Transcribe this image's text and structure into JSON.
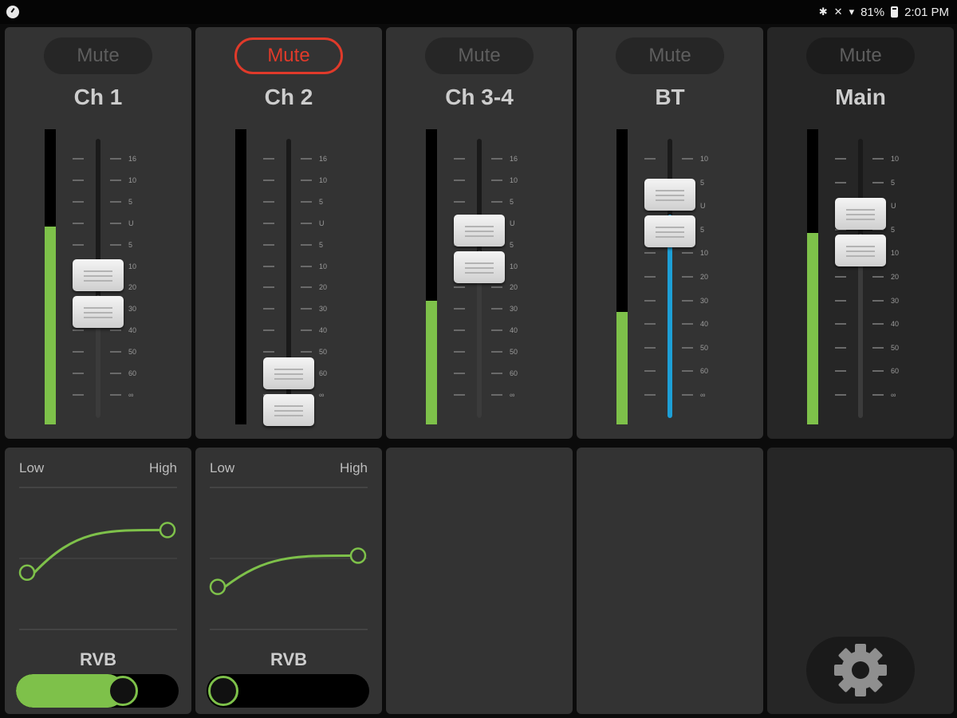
{
  "status_bar": {
    "left_icon": "app-notification-icon",
    "icons": [
      "bluetooth-icon",
      "mute-notifications-icon",
      "wifi-icon"
    ],
    "battery": "81%",
    "battery_level": 0.81,
    "time": "2:01 PM"
  },
  "fader_scale_channel": [
    "16",
    "10",
    "5",
    "U",
    "5",
    "10",
    "20",
    "30",
    "40",
    "50",
    "60",
    "∞"
  ],
  "fader_scale_bt": [
    "10",
    "5",
    "U",
    "5",
    "10",
    "20",
    "30",
    "40",
    "50",
    "60",
    "∞"
  ],
  "fader_scale_main": [
    "10",
    "5",
    "U",
    "5",
    "10",
    "20",
    "30",
    "40",
    "50",
    "60",
    "∞"
  ],
  "channels": [
    {
      "name": "Ch 1",
      "mute_label": "Mute",
      "muted": false,
      "meter_level": 0.67,
      "fader_level": 0.44,
      "fader_fill_color": "#3b3b3b"
    },
    {
      "name": "Ch 2",
      "mute_label": "Mute",
      "muted": true,
      "meter_level": 0.0,
      "fader_level": 0.0,
      "fader_fill_color": "#3b3b3b"
    },
    {
      "name": "Ch 3-4",
      "mute_label": "Mute",
      "muted": false,
      "meter_level": 0.42,
      "fader_level": 0.6,
      "fader_fill_color": "#3b3b3b"
    },
    {
      "name": "BT",
      "mute_label": "Mute",
      "muted": false,
      "meter_level": 0.38,
      "fader_level": 0.73,
      "fader_fill_color": "#1d9fd6"
    },
    {
      "name": "Main",
      "mute_label": "Mute",
      "muted": false,
      "meter_level": 0.65,
      "fader_level": 0.66,
      "fader_fill_color": "#3b3b3b"
    }
  ],
  "eq_panels": [
    {
      "low_label": "Low",
      "high_label": "High",
      "low": 0.4,
      "high": 0.7,
      "rvb_label": "RVB",
      "rvb_level": 0.7
    },
    {
      "low_label": "Low",
      "high_label": "High",
      "low": 0.3,
      "high": 0.52,
      "rvb_label": "RVB",
      "rvb_level": 0.0
    }
  ],
  "colors": {
    "accent_green": "#7ec14a",
    "mute_red": "#e03a2a",
    "bt_blue": "#1d9fd6"
  },
  "settings": {
    "icon": "gear-icon"
  }
}
